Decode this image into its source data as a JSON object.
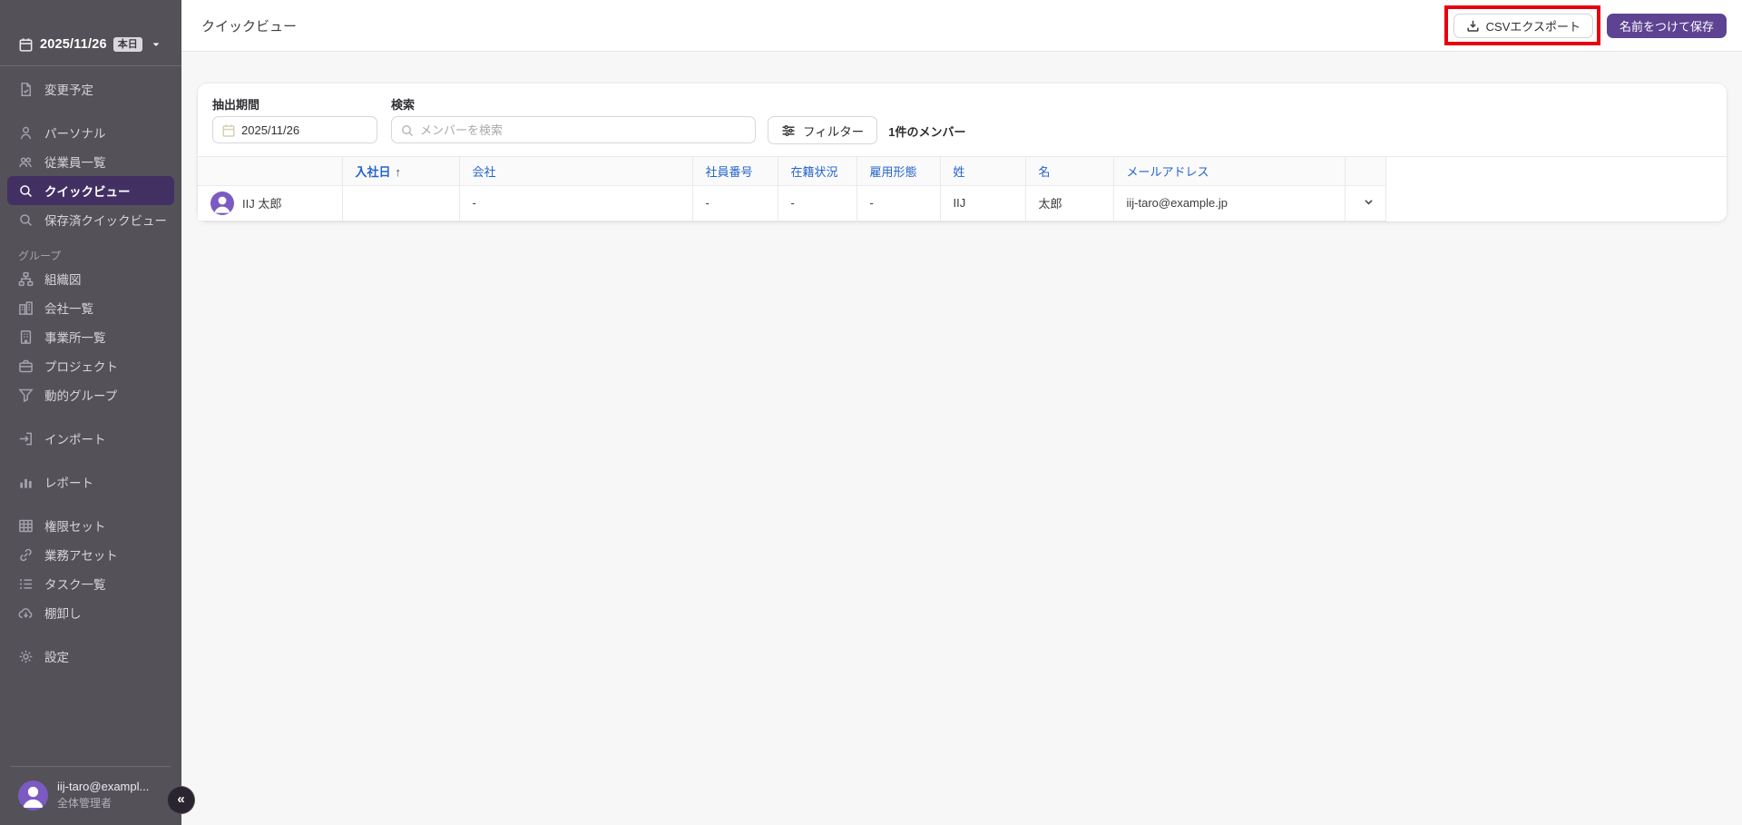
{
  "colors": {
    "sidebar_bg": "#545158",
    "active_purple": "#433063",
    "accent_purple": "#5d4392",
    "avatar_purple": "#7b5bc1",
    "link_blue": "#2364cc",
    "annotation_red": "#e8000f"
  },
  "sidebar": {
    "date_selector": {
      "icon": "calendar-icon",
      "date": "2025/11/26",
      "badge": "本日",
      "caret": "caret-down-icon"
    },
    "groups": [
      {
        "label": null,
        "items": [
          {
            "id": "change-schedule",
            "icon": "document-check-icon",
            "label": "変更予定"
          }
        ]
      },
      {
        "label": null,
        "items": [
          {
            "id": "personal",
            "icon": "person-icon",
            "label": "パーソナル"
          },
          {
            "id": "employee-list",
            "icon": "people-icon",
            "label": "従業員一覧"
          },
          {
            "id": "quick-view",
            "icon": "search-icon",
            "label": "クイックビュー",
            "active": true
          },
          {
            "id": "saved-quick-view",
            "icon": "search-icon",
            "label": "保存済クイックビュー"
          }
        ]
      },
      {
        "label": "グループ",
        "items": [
          {
            "id": "org-chart",
            "icon": "org-chart-icon",
            "label": "組織図"
          },
          {
            "id": "company-list",
            "icon": "buildings-icon",
            "label": "会社一覧"
          },
          {
            "id": "office-list",
            "icon": "building-icon",
            "label": "事業所一覧"
          },
          {
            "id": "project",
            "icon": "briefcase-icon",
            "label": "プロジェクト"
          },
          {
            "id": "dynamic-group",
            "icon": "funnel-icon",
            "label": "動的グループ"
          }
        ]
      },
      {
        "label": null,
        "items": [
          {
            "id": "import",
            "icon": "import-icon",
            "label": "インポート"
          }
        ]
      },
      {
        "label": null,
        "items": [
          {
            "id": "report",
            "icon": "bar-chart-icon",
            "label": "レポート"
          }
        ]
      },
      {
        "label": null,
        "items": [
          {
            "id": "permission-set",
            "icon": "grid-icon",
            "label": "権限セット"
          },
          {
            "id": "business-asset",
            "icon": "link-icon",
            "label": "業務アセット"
          },
          {
            "id": "task-list",
            "icon": "task-list-icon",
            "label": "タスク一覧"
          },
          {
            "id": "inventory",
            "icon": "cloud-download-icon",
            "label": "棚卸し"
          }
        ]
      },
      {
        "label": null,
        "items": [
          {
            "id": "settings",
            "icon": "gear-icon",
            "label": "設定"
          }
        ]
      }
    ],
    "user": {
      "email": "iij-taro@exampl...",
      "role": "全体管理者"
    },
    "collapse_glyph": "«"
  },
  "header": {
    "title": "クイックビュー",
    "csv_export_label": "CSVエクスポート",
    "save_as_label": "名前をつけて保存"
  },
  "filters": {
    "period_label": "抽出期間",
    "period_value": "2025/11/26",
    "search_label": "検索",
    "search_placeholder": "メンバーを検索",
    "filter_button_label": "フィルター",
    "member_count": "1件のメンバー"
  },
  "table": {
    "sort_arrow": "↑",
    "columns": [
      {
        "id": "member",
        "label": ""
      },
      {
        "id": "hire-date",
        "label": "入社日",
        "sorted": true
      },
      {
        "id": "company",
        "label": "会社"
      },
      {
        "id": "employee-no",
        "label": "社員番号"
      },
      {
        "id": "enrollment-status",
        "label": "在籍状況"
      },
      {
        "id": "employment-type",
        "label": "雇用形態"
      },
      {
        "id": "last-name",
        "label": "姓"
      },
      {
        "id": "first-name",
        "label": "名"
      },
      {
        "id": "email",
        "label": "メールアドレス"
      },
      {
        "id": "actions",
        "label": ""
      }
    ],
    "rows": [
      {
        "name": "IIJ 太郎",
        "cells": [
          "",
          "-",
          "-",
          "-",
          "-",
          "IIJ",
          "太郎",
          "iij-taro@example.jp"
        ]
      }
    ]
  }
}
